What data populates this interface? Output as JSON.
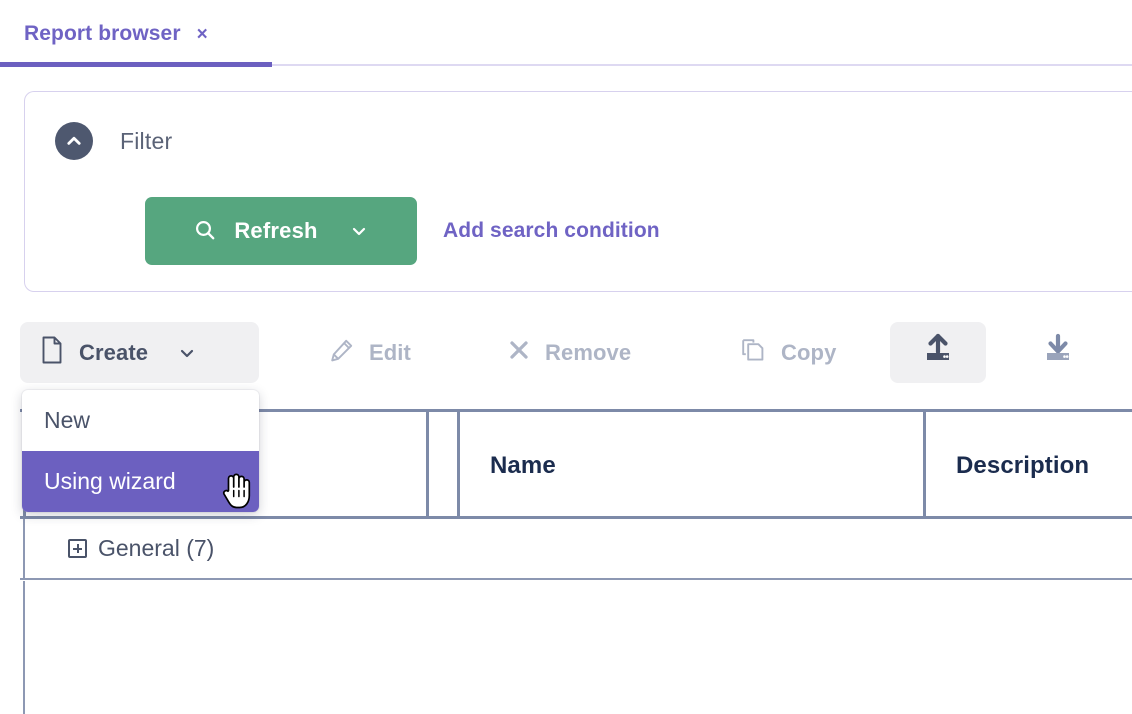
{
  "tab": {
    "label": "Report browser",
    "close_icon": "close-icon",
    "close_glyph": "×",
    "accent_color": "#6c60c0"
  },
  "filter": {
    "title": "Filter",
    "collapse_icon": "chevron-up-icon",
    "refresh": {
      "label": "Refresh",
      "search_icon": "search-icon",
      "caret_icon": "chevron-down-icon",
      "color": "#56a67f"
    },
    "add_condition_label": "Add search condition"
  },
  "toolbar": {
    "items": [
      {
        "label": "Create",
        "icon": "document-icon",
        "enabled": true,
        "has_caret": true,
        "caret_icon": "chevron-down-icon"
      },
      {
        "label": "Edit",
        "icon": "pencil-icon",
        "enabled": false,
        "has_caret": false
      },
      {
        "label": "Remove",
        "icon": "cross-icon",
        "enabled": false,
        "has_caret": false
      },
      {
        "label": "Copy",
        "icon": "copy-icon",
        "enabled": false,
        "has_caret": false
      }
    ],
    "import_icon": "upload-icon",
    "export_icon": "download-icon"
  },
  "create_menu": {
    "items": [
      {
        "label": "New",
        "highlighted": false
      },
      {
        "label": "Using wizard",
        "highlighted": true
      }
    ],
    "highlight_color": "#6c60c0"
  },
  "table": {
    "columns": [
      "Name",
      "Description"
    ],
    "group_row": {
      "label": "General (7)",
      "expand_icon": "expand-plus-icon"
    },
    "rows": []
  },
  "cursor": {
    "type": "pointer-hand-cursor"
  }
}
